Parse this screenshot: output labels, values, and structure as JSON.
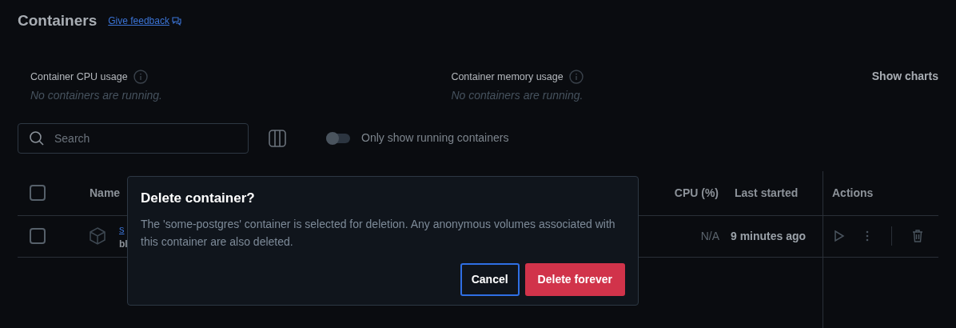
{
  "page": {
    "title": "Containers",
    "feedback_link": "Give feedback"
  },
  "stats": [
    {
      "label": "Container CPU usage",
      "message": "No containers are running."
    },
    {
      "label": "Container memory usage",
      "message": "No containers are running."
    }
  ],
  "show_charts": "Show charts",
  "search": {
    "placeholder": "Search"
  },
  "running_toggle": {
    "label": "Only show running containers",
    "on": false
  },
  "table": {
    "select_all": {
      "checked": false
    },
    "columns": [
      "Name",
      "CPU (%)",
      "Last started",
      "Actions"
    ],
    "rows": [
      {
        "checked": false,
        "name": "s",
        "image": "bl",
        "cpu": "N/A",
        "last_started": "9 minutes ago"
      }
    ]
  },
  "dialog": {
    "title": "Delete container?",
    "message": "The 'some-postgres' container is selected for deletion. Any anonymous volumes associated with this container are also deleted.",
    "buttons": [
      {
        "label": "Cancel",
        "kind": "secondary"
      },
      {
        "label": "Delete forever",
        "kind": "danger"
      }
    ]
  }
}
